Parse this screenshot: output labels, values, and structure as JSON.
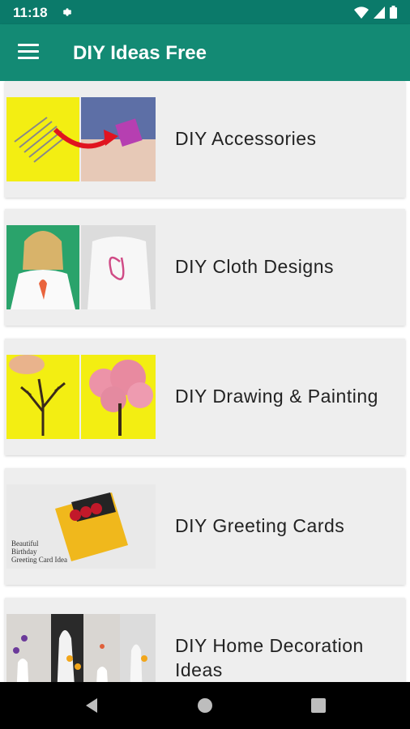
{
  "status": {
    "time": "11:18"
  },
  "app_bar": {
    "title": "DIY Ideas Free"
  },
  "categories": [
    {
      "label": "DIY Accessories",
      "thumb_text": ""
    },
    {
      "label": "DIY Cloth Designs"
    },
    {
      "label": "DIY Drawing & Painting"
    },
    {
      "label": "DIY Greeting Cards",
      "thumb_text": "Beautiful Birthday Greeting Card Idea"
    },
    {
      "label": "DIY Home Decoration Ideas"
    }
  ],
  "colors": {
    "status_bar": "#0b7a6a",
    "app_bar": "#138a74",
    "card_bg": "#eeeeee",
    "nav_bar": "#000000"
  }
}
